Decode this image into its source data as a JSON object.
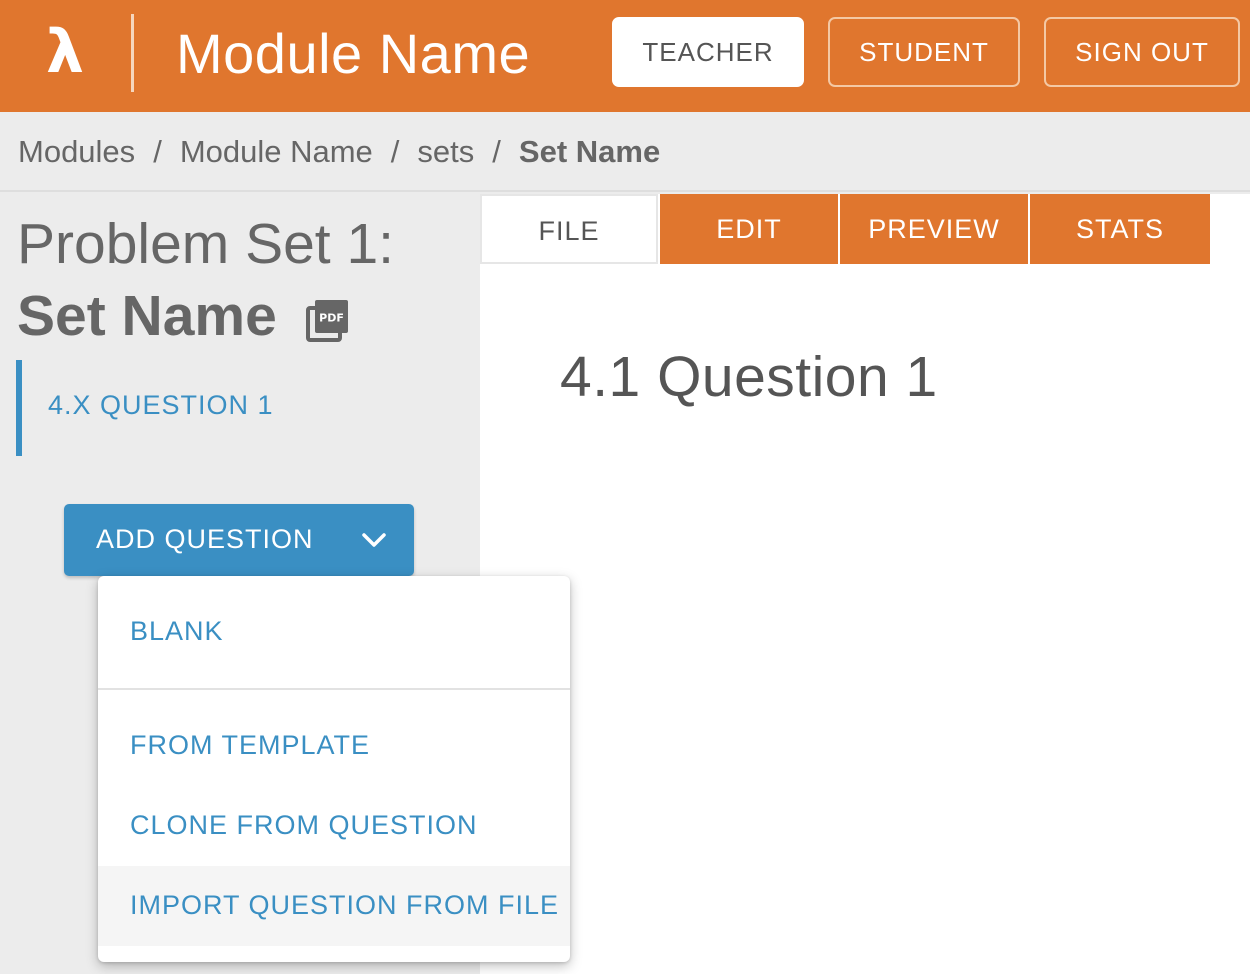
{
  "header": {
    "logo": "λ",
    "module_name": "Module Name",
    "teacher_label": "TEACHER",
    "student_label": "STUDENT",
    "signout_label": "SIGN OUT"
  },
  "breadcrumb": {
    "items": [
      "Modules",
      "Module Name",
      "sets"
    ],
    "current": "Set Name",
    "separator": "/"
  },
  "sidebar": {
    "title_line1": "Problem Set 1:",
    "title_line2": "Set Name",
    "pdf_icon": "pdf-icon",
    "questions": [
      {
        "label": "4.X QUESTION 1"
      }
    ],
    "add_question_label": "ADD QUESTION"
  },
  "tabs": [
    {
      "label": "FILE"
    },
    {
      "label": "EDIT"
    },
    {
      "label": "PREVIEW"
    },
    {
      "label": "STATS"
    }
  ],
  "main": {
    "question_heading": "4.1 Question 1"
  },
  "add_menu": {
    "items": [
      {
        "label": "BLANK"
      },
      {
        "label": "FROM TEMPLATE"
      },
      {
        "label": "CLONE FROM QUESTION"
      },
      {
        "label": "IMPORT QUESTION FROM FILE"
      }
    ]
  },
  "colors": {
    "accent": "#e0762e",
    "link": "#3a8fc3",
    "background": "#ececec"
  }
}
